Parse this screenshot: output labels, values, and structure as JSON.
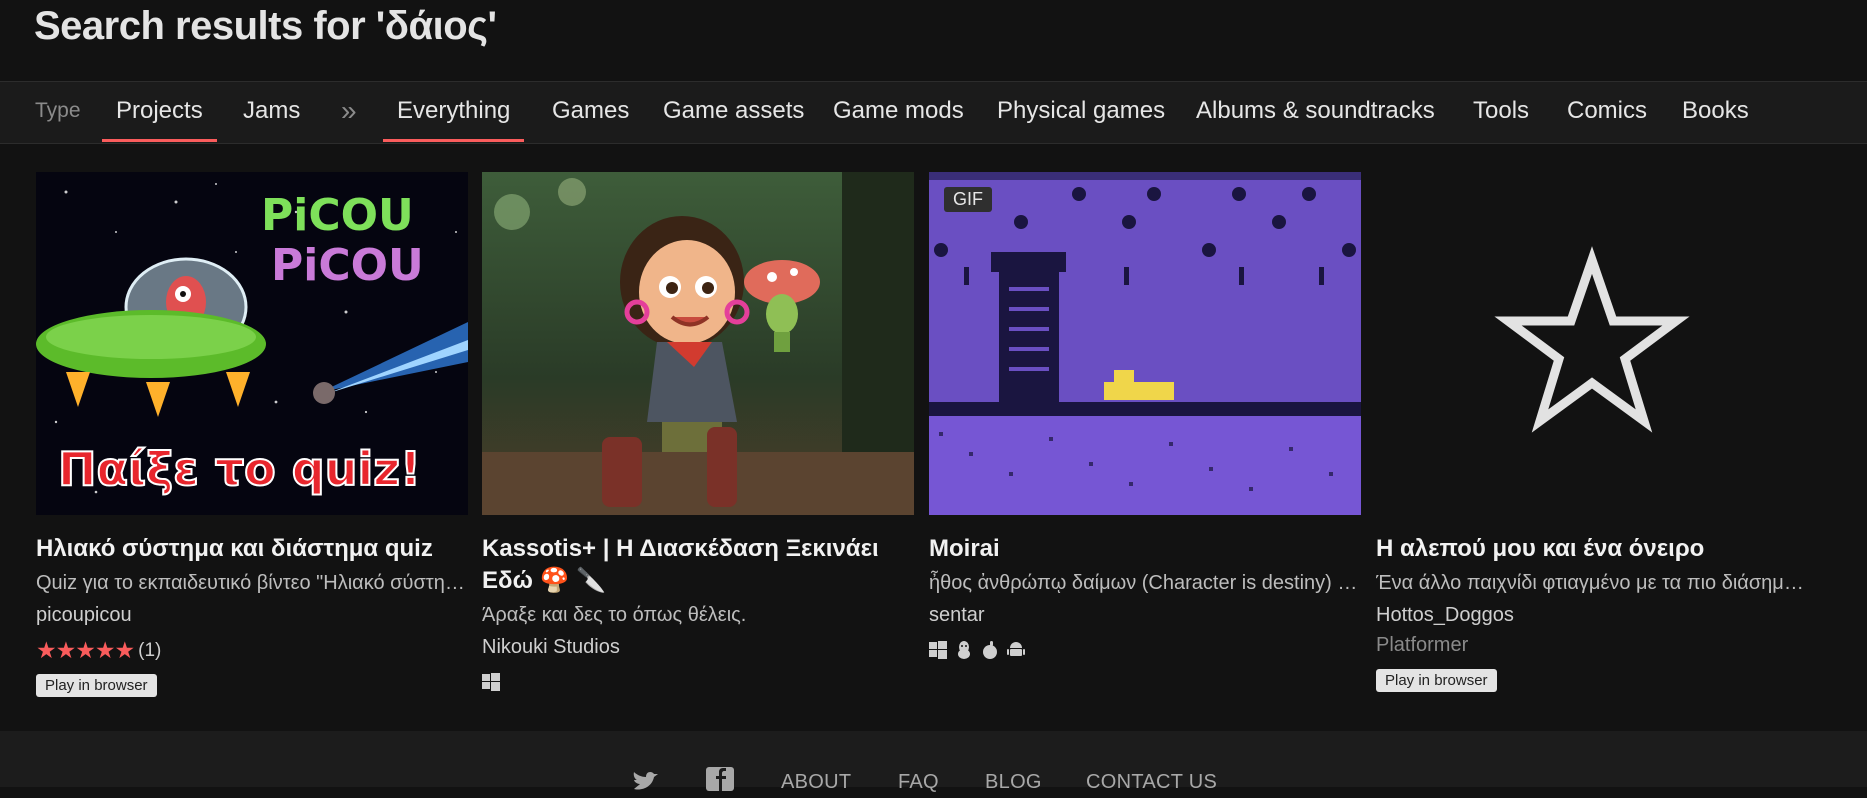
{
  "page": {
    "title": "Search results for 'δάιος'"
  },
  "nav": {
    "type_label": "Type",
    "tabs": [
      "Projects",
      "Jams"
    ],
    "separator": "»",
    "classifications": [
      "Everything",
      "Games",
      "Game assets",
      "Game mods",
      "Physical games",
      "Albums & soundtracks",
      "Tools",
      "Comics",
      "Books"
    ]
  },
  "results": [
    {
      "thumb": {
        "title_line1": "PiCOU",
        "title_line2": "PiCOU",
        "cta": "Παίξε το quiz!"
      },
      "title": "Ηλιακό σύστημα και διάστημα quiz",
      "short_text": "Quiz για το εκπαιδευτικό βίντεο \"Ηλιακό σύστημα και διάστημα\"",
      "author": "picoupicou",
      "rating_count": "(1)",
      "rating_stars": 5,
      "badge": "Play in browser"
    },
    {
      "title": "Kassotis+ | Η Διασκέδαση Ξεκινάει Εδώ 🍄 🔪",
      "short_text": "Άραξε και δες το όπως θέλεις.",
      "author": "Nikouki Studios",
      "platforms": [
        "windows-icon"
      ]
    },
    {
      "thumb": {
        "gif_label": "GIF"
      },
      "title": "Moirai",
      "short_text": "ἦθος ἀνθρώπῳ δαίμων (Character is destiny) - Heraclitus",
      "author": "sentar",
      "platforms": [
        "windows-icon",
        "linux-icon",
        "apple-icon",
        "android-icon"
      ]
    },
    {
      "title": "Η αλεπού μου και ένα όνειρο",
      "short_text": "Ένα άλλο παιχνίδι φτιαγμένο με τα πιο διάσημα εργαλεία",
      "author": "Hottos_Doggos",
      "genre": "Platformer",
      "badge": "Play in browser"
    }
  ],
  "footer": {
    "links": [
      "ABOUT",
      "FAQ",
      "BLOG",
      "CONTACT US"
    ]
  },
  "colors": {
    "accent": "#fa5c5c",
    "background": "#121212",
    "bar": "#1b1b1b"
  }
}
